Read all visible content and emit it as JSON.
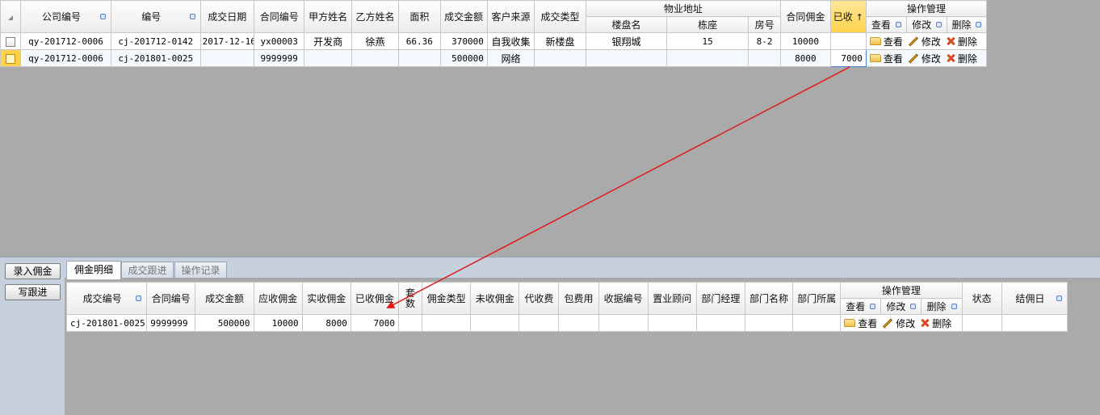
{
  "top_grid": {
    "headers": {
      "company_no": "公司编号",
      "no": "编号",
      "deal_date": "成交日期",
      "contract_no": "合同编号",
      "party_a": "甲方姓名",
      "party_b": "乙方姓名",
      "area": "面积",
      "deal_amount": "成交金额",
      "customer_source": "客户来源",
      "deal_type": "成交类型",
      "property_address": "物业地址",
      "building_name": "楼盘名",
      "building_block": "栋座",
      "room_no": "房号",
      "contract_commission": "合同佣金",
      "received": "已收",
      "operations": "操作管理",
      "view": "查看",
      "edit": "修改",
      "delete": "删除"
    },
    "sort_indicator": "↑",
    "rows": [
      {
        "company_no": "qy-201712-0006",
        "no": "cj-201712-0142",
        "deal_date": "2017-12-16",
        "contract_no": "yx00003",
        "party_a": "开发商",
        "party_b": "徐燕",
        "area": "66.36",
        "deal_amount": "370000",
        "customer_source": "自我收集",
        "deal_type": "新楼盘",
        "building_name": "银翔城",
        "building_block": "15",
        "room_no": "8-2",
        "contract_commission": "10000",
        "received": "",
        "view": "查看",
        "edit": "修改",
        "delete": "删除"
      },
      {
        "company_no": "qy-201712-0006",
        "no": "cj-201801-0025",
        "deal_date": "",
        "contract_no": "9999999",
        "party_a": "",
        "party_b": "",
        "area": "",
        "deal_amount": "500000",
        "customer_source": "网络",
        "deal_type": "",
        "building_name": "",
        "building_block": "",
        "room_no": "",
        "contract_commission": "8000",
        "received": "7000",
        "view": "查看",
        "edit": "修改",
        "delete": "删除"
      }
    ]
  },
  "side_buttons": {
    "enter_commission": "录入佣金",
    "write_followup": "写跟进"
  },
  "tabs": [
    "佣金明细",
    "成交跟进",
    "操作记录"
  ],
  "bottom_grid": {
    "headers": {
      "deal_no": "成交编号",
      "contract_no": "合同编号",
      "deal_amount": "成交金额",
      "receivable": "应收佣金",
      "actual": "实收佣金",
      "received": "已收佣金",
      "sets": "套数",
      "commission_type": "佣金类型",
      "uncollected": "未收佣金",
      "collection": "代收费",
      "inclusive_fee": "包费用",
      "receipt_no": "收据编号",
      "consultant": "置业顾问",
      "dept_manager": "部门经理",
      "dept_name": "部门名称",
      "dept_belong": "部门所属",
      "operations": "操作管理",
      "view": "查看",
      "edit": "修改",
      "delete": "删除",
      "status": "状态",
      "settle_date": "结佣日"
    },
    "rows": [
      {
        "deal_no": "cj-201801-0025",
        "contract_no": "9999999",
        "deal_amount": "500000",
        "receivable": "10000",
        "actual": "8000",
        "received": "7000",
        "view": "查看",
        "edit": "修改",
        "delete": "删除"
      }
    ]
  },
  "colors": {
    "arrow": "#e01b1b",
    "sort_header": "#ffd24a",
    "panel": "#c7d0dd",
    "background": "#aaaaaa"
  }
}
